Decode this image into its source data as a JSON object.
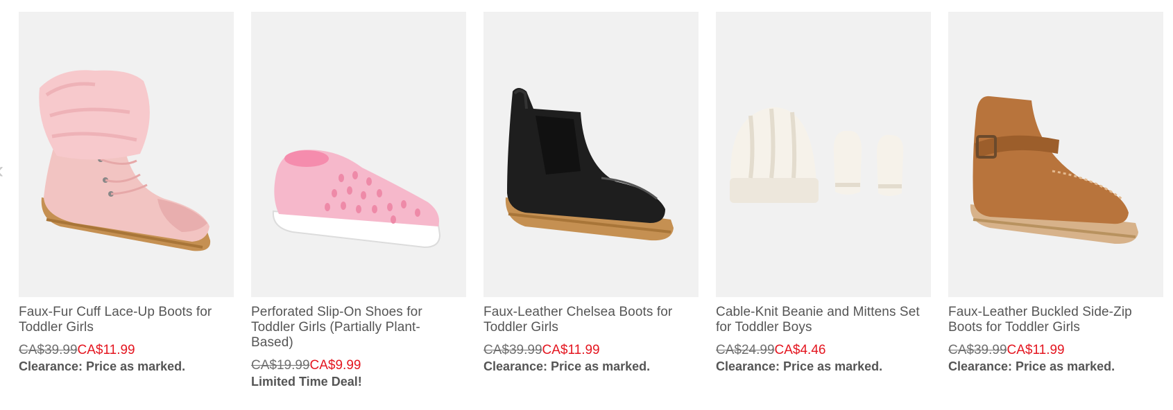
{
  "carousel": {
    "prev_icon": "chevron-left-icon",
    "products": [
      {
        "name": "Faux-Fur Cuff Lace-Up Boots for Toddler Girls",
        "was_price": "CA$39.99",
        "sale_price": "CA$11.99",
        "promo": "Clearance: Price as marked.",
        "image": "pink-faux-fur-boot"
      },
      {
        "name": "Perforated Slip-On Shoes for Toddler Girls (Partially Plant-Based)",
        "was_price": "CA$19.99",
        "sale_price": "CA$9.99",
        "promo": "Limited Time Deal!",
        "image": "pink-perforated-slip-on"
      },
      {
        "name": "Faux-Leather Chelsea Boots for Toddler Girls",
        "was_price": "CA$39.99",
        "sale_price": "CA$11.99",
        "promo": "Clearance: Price as marked.",
        "image": "black-chelsea-boot"
      },
      {
        "name": "Cable-Knit Beanie and Mittens Set for Toddler Boys",
        "was_price": "CA$24.99",
        "sale_price": "CA$4.46",
        "promo": "Clearance: Price as marked.",
        "image": "cream-beanie-mittens"
      },
      {
        "name": "Faux-Leather Buckled Side-Zip Boots for Toddler Girls",
        "was_price": "CA$39.99",
        "sale_price": "CA$11.99",
        "promo": "Clearance: Price as marked.",
        "image": "tan-buckled-boot"
      }
    ]
  },
  "colors": {
    "sale": "#e4151f",
    "text": "#555555",
    "image_bg": "#f1f1f1"
  }
}
